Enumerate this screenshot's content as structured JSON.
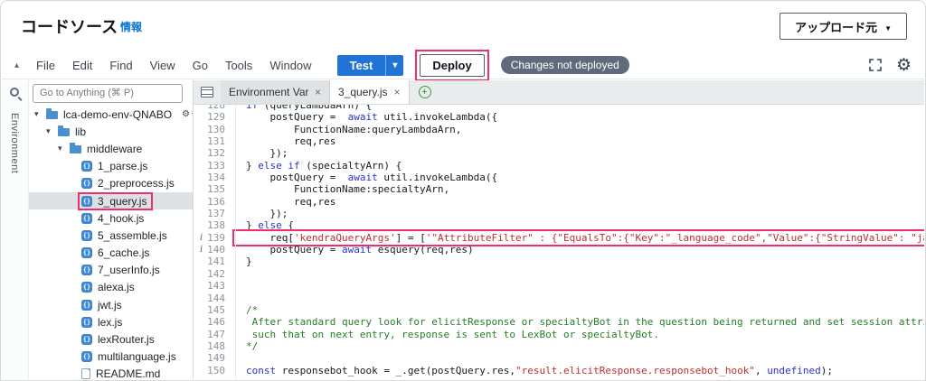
{
  "colors": {
    "accent": "#2074d5",
    "annotation": "#ee2e6d"
  },
  "header": {
    "title": "コードソース",
    "info_link": "情報",
    "upload_label": "アップロード元"
  },
  "menubar": {
    "items": [
      "File",
      "Edit",
      "Find",
      "View",
      "Go",
      "Tools",
      "Window"
    ],
    "test_label": "Test",
    "deploy_label": "Deploy",
    "badge": "Changes not deployed"
  },
  "sidebar": {
    "goto_placeholder": "Go to Anything (⌘ P)",
    "rail_label": "Environment",
    "tree": [
      {
        "icon": "folder",
        "label": "lca-demo-env-QNABO",
        "level": 0,
        "arrow": true,
        "gear": true,
        "selected": false,
        "annotated": false
      },
      {
        "icon": "folder",
        "label": "lib",
        "level": 1,
        "arrow": true,
        "gear": false,
        "selected": false,
        "annotated": false
      },
      {
        "icon": "folder",
        "label": "middleware",
        "level": 2,
        "arrow": true,
        "gear": false,
        "selected": false,
        "annotated": false
      },
      {
        "icon": "js",
        "label": "1_parse.js",
        "level": 3,
        "arrow": false,
        "gear": false,
        "selected": false,
        "annotated": false
      },
      {
        "icon": "js",
        "label": "2_preprocess.js",
        "level": 3,
        "arrow": false,
        "gear": false,
        "selected": false,
        "annotated": false
      },
      {
        "icon": "js",
        "label": "3_query.js",
        "level": 3,
        "arrow": false,
        "gear": false,
        "selected": true,
        "annotated": true
      },
      {
        "icon": "js",
        "label": "4_hook.js",
        "level": 3,
        "arrow": false,
        "gear": false,
        "selected": false,
        "annotated": false
      },
      {
        "icon": "js",
        "label": "5_assemble.js",
        "level": 3,
        "arrow": false,
        "gear": false,
        "selected": false,
        "annotated": false
      },
      {
        "icon": "js",
        "label": "6_cache.js",
        "level": 3,
        "arrow": false,
        "gear": false,
        "selected": false,
        "annotated": false
      },
      {
        "icon": "js",
        "label": "7_userInfo.js",
        "level": 3,
        "arrow": false,
        "gear": false,
        "selected": false,
        "annotated": false
      },
      {
        "icon": "js",
        "label": "alexa.js",
        "level": 3,
        "arrow": false,
        "gear": false,
        "selected": false,
        "annotated": false
      },
      {
        "icon": "js",
        "label": "jwt.js",
        "level": 3,
        "arrow": false,
        "gear": false,
        "selected": false,
        "annotated": false
      },
      {
        "icon": "js",
        "label": "lex.js",
        "level": 3,
        "arrow": false,
        "gear": false,
        "selected": false,
        "annotated": false
      },
      {
        "icon": "js",
        "label": "lexRouter.js",
        "level": 3,
        "arrow": false,
        "gear": false,
        "selected": false,
        "annotated": false
      },
      {
        "icon": "js",
        "label": "multilanguage.js",
        "level": 3,
        "arrow": false,
        "gear": false,
        "selected": false,
        "annotated": false
      },
      {
        "icon": "md",
        "label": "README.md",
        "level": 3,
        "arrow": false,
        "gear": false,
        "selected": false,
        "annotated": false
      }
    ]
  },
  "tabs": [
    {
      "label": "Environment Var",
      "active": false
    },
    {
      "label": "3_query.js",
      "active": true
    }
  ],
  "editor": {
    "lines": [
      {
        "n": 128,
        "info": false,
        "annotated": false,
        "tokens": [
          [
            "k",
            "if"
          ],
          [
            "t",
            " (queryLambdaArn) {"
          ]
        ]
      },
      {
        "n": 129,
        "info": false,
        "annotated": false,
        "tokens": [
          [
            "t",
            "    postQuery =  "
          ],
          [
            "k",
            "await"
          ],
          [
            "t",
            " util.invokeLambda({"
          ]
        ]
      },
      {
        "n": 130,
        "info": false,
        "annotated": false,
        "tokens": [
          [
            "t",
            "        FunctionName:queryLambdaArn,"
          ]
        ]
      },
      {
        "n": 131,
        "info": false,
        "annotated": false,
        "tokens": [
          [
            "t",
            "        req,res"
          ]
        ]
      },
      {
        "n": 132,
        "info": false,
        "annotated": false,
        "tokens": [
          [
            "t",
            "    });"
          ]
        ]
      },
      {
        "n": 133,
        "info": false,
        "annotated": false,
        "tokens": [
          [
            "t",
            "} "
          ],
          [
            "k",
            "else"
          ],
          [
            "t",
            " "
          ],
          [
            "k",
            "if"
          ],
          [
            "t",
            " (specialtyArn) {"
          ]
        ]
      },
      {
        "n": 134,
        "info": false,
        "annotated": false,
        "tokens": [
          [
            "t",
            "    postQuery =  "
          ],
          [
            "k",
            "await"
          ],
          [
            "t",
            " util.invokeLambda({"
          ]
        ]
      },
      {
        "n": 135,
        "info": false,
        "annotated": false,
        "tokens": [
          [
            "t",
            "        FunctionName:specialtyArn,"
          ]
        ]
      },
      {
        "n": 136,
        "info": false,
        "annotated": false,
        "tokens": [
          [
            "t",
            "        req,res"
          ]
        ]
      },
      {
        "n": 137,
        "info": false,
        "annotated": false,
        "tokens": [
          [
            "t",
            "    });"
          ]
        ]
      },
      {
        "n": 138,
        "info": false,
        "annotated": false,
        "tokens": [
          [
            "t",
            "} "
          ],
          [
            "k",
            "else"
          ],
          [
            "t",
            " {"
          ]
        ]
      },
      {
        "n": 139,
        "info": true,
        "annotated": true,
        "tokens": [
          [
            "t",
            "    req["
          ],
          [
            "s",
            "'kendraQueryArgs'"
          ],
          [
            "t",
            "] = ["
          ],
          [
            "s",
            "'\"AttributeFilter\" : {\"EqualsTo\":{\"Key\":\"_language_code\",\"Value\":{\"StringValue\": \"ja\"}}}'"
          ],
          [
            "t",
            "]"
          ]
        ]
      },
      {
        "n": 140,
        "info": true,
        "annotated": false,
        "tokens": [
          [
            "t",
            "    postQuery = "
          ],
          [
            "k",
            "await"
          ],
          [
            "t",
            " esquery(req,res)"
          ]
        ]
      },
      {
        "n": 141,
        "info": false,
        "annotated": false,
        "tokens": [
          [
            "t",
            "}"
          ]
        ]
      },
      {
        "n": 142,
        "info": false,
        "annotated": false,
        "tokens": []
      },
      {
        "n": 143,
        "info": false,
        "annotated": false,
        "tokens": []
      },
      {
        "n": 144,
        "info": false,
        "annotated": false,
        "tokens": []
      },
      {
        "n": 145,
        "info": false,
        "annotated": false,
        "tokens": [
          [
            "c",
            "/*"
          ]
        ]
      },
      {
        "n": 146,
        "info": false,
        "annotated": false,
        "tokens": [
          [
            "c",
            " After standard query look for elicitResponse or specialtyBot in the question being returned and set session attributes"
          ]
        ]
      },
      {
        "n": 147,
        "info": false,
        "annotated": false,
        "tokens": [
          [
            "c",
            " such that on next entry, response is sent to LexBot or specialtyBot."
          ]
        ]
      },
      {
        "n": 148,
        "info": false,
        "annotated": false,
        "tokens": [
          [
            "c",
            "*/"
          ]
        ]
      },
      {
        "n": 149,
        "info": false,
        "annotated": false,
        "tokens": []
      },
      {
        "n": 150,
        "info": false,
        "annotated": false,
        "tokens": [
          [
            "k",
            "const"
          ],
          [
            "t",
            " responsebot_hook = _.get(postQuery.res,"
          ],
          [
            "s",
            "\"result.elicitResponse.responsebot_hook\""
          ],
          [
            "t",
            ", "
          ],
          [
            "k",
            "undefined"
          ],
          [
            "t",
            ");"
          ]
        ]
      }
    ]
  }
}
